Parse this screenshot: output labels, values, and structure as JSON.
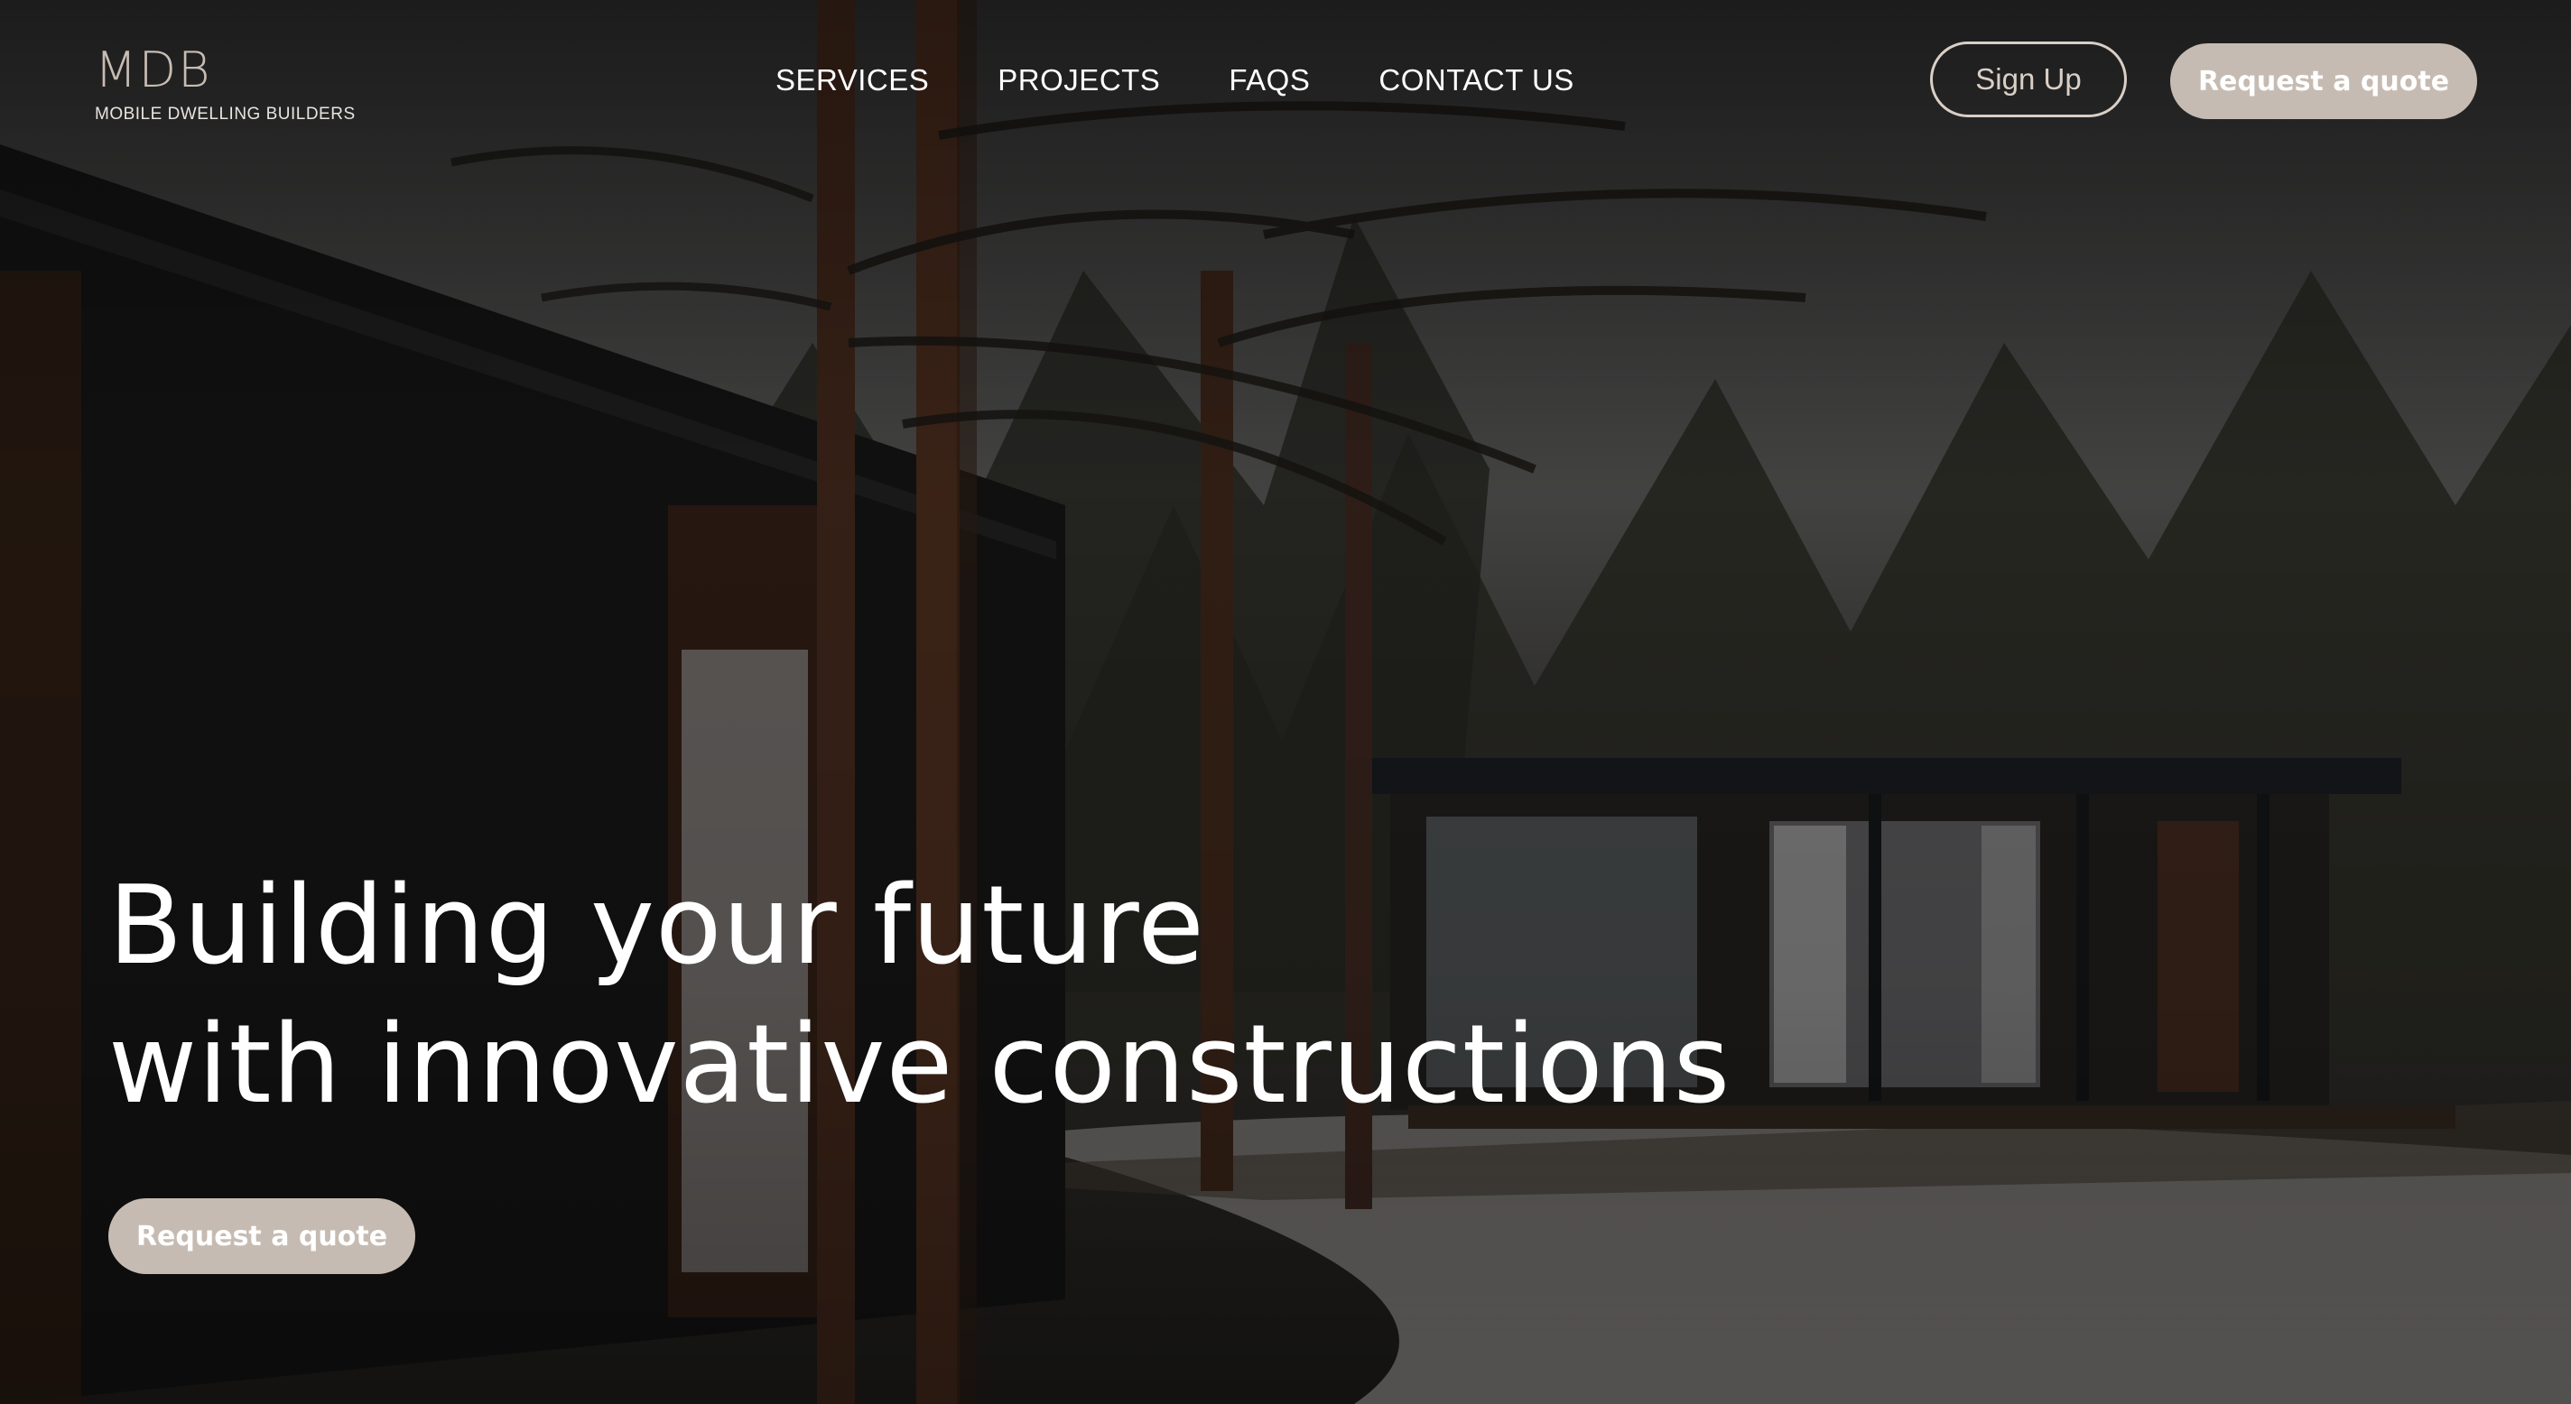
{
  "header": {
    "logo": {
      "mark": "MDB",
      "tagline": "MOBILE DWELLING BUILDERS"
    },
    "nav": [
      {
        "label": "SERVICES"
      },
      {
        "label": "PROJECTS"
      },
      {
        "label": "FAQS"
      },
      {
        "label": "CONTACT US"
      }
    ],
    "signup_label": "Sign Up",
    "quote_label": "Request a quote"
  },
  "hero": {
    "headline_line1": "Building your future",
    "headline_line2": "with innovative constructions",
    "cta_label": "Request a quote",
    "background_image": "dark pine forest with modern modular cabins and light snow"
  },
  "colors": {
    "accent": "#c6bbb2",
    "outline": "#d9cfc7",
    "text": "#ffffff"
  }
}
